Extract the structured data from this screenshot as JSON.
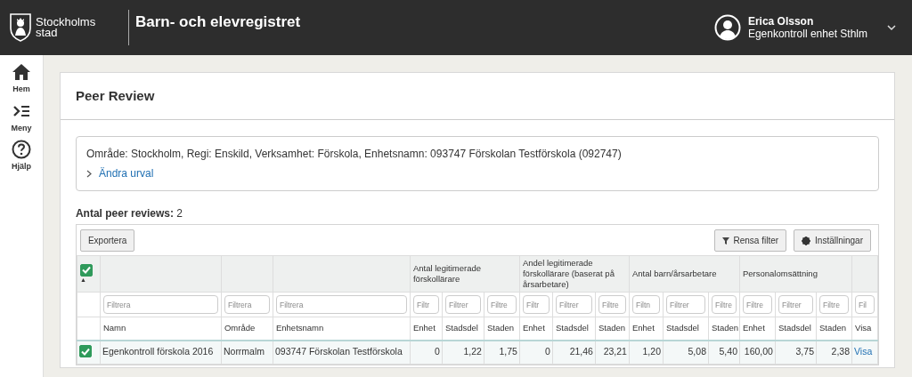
{
  "header": {
    "logo_lines": [
      "Stockholms",
      "stad"
    ],
    "app_title": "Barn- och elevregistret",
    "user": {
      "name": "Erica Olsson",
      "role": "Egenkontroll enhet Sthlm"
    }
  },
  "sidebar": {
    "items": [
      {
        "kind": "home",
        "label": "Hem"
      },
      {
        "kind": "menu",
        "label": "Meny"
      },
      {
        "kind": "help",
        "label": "Hjälp"
      }
    ]
  },
  "page": {
    "title": "Peer Review",
    "selection": {
      "text": "Område: Stockholm, Regi: Enskild, Verksamhet: Förskola, Enhetsnamn: 093747 Förskolan Testförskola (092747)",
      "link": "Ändra urval",
      "expanded": false
    },
    "count_label": "Antal peer reviews:",
    "count_value": "2",
    "toolbar": {
      "export": "Exportera",
      "clear_filter": "Rensa filter",
      "settings": "Inställningar"
    },
    "table": {
      "select_all_checked": true,
      "sort_indicator": "▲",
      "groups": [
        "Antal legitimerade förskollärare",
        "Andel legitimerade förskollärare (baserat på årsarbetare)",
        "Antal barn/årsarbetare",
        "Personalomsättning"
      ],
      "filters": [
        {
          "placeholder": "Filtrera"
        },
        {
          "placeholder": "Filtrera"
        },
        {
          "placeholder": "Filtrera"
        },
        {
          "placeholder": "Filtr"
        },
        {
          "placeholder": "Filtrer"
        },
        {
          "placeholder": "Filtre"
        },
        {
          "placeholder": "Filtr"
        },
        {
          "placeholder": "Filtrer"
        },
        {
          "placeholder": "Filtre"
        },
        {
          "placeholder": "Filtn"
        },
        {
          "placeholder": "Filtrer"
        },
        {
          "placeholder": "Filtre"
        },
        {
          "placeholder": "Filtre"
        },
        {
          "placeholder": "Filtrer"
        },
        {
          "placeholder": "Filtre"
        },
        {
          "placeholder": "Fil"
        }
      ],
      "columns": [
        "Namn",
        "Område",
        "Enhetsnamn",
        "Enhet",
        "Stadsdel",
        "Staden",
        "Enhet",
        "Stadsdel",
        "Staden",
        "Enhet",
        "Stadsdel",
        "Staden",
        "Enhet",
        "Stadsdel",
        "Staden",
        "Visa"
      ],
      "rows": [
        {
          "checked": true,
          "cells": [
            "Egenkontroll förskola 2016",
            "Norrmalm",
            "093747 Förskolan Testförskola",
            "0",
            "1,22",
            "1,75",
            "0",
            "21,46",
            "23,21",
            "1,20",
            "5,08",
            "5,40",
            "160,00",
            "3,75",
            "2,38"
          ],
          "link": "Visa"
        }
      ]
    }
  }
}
